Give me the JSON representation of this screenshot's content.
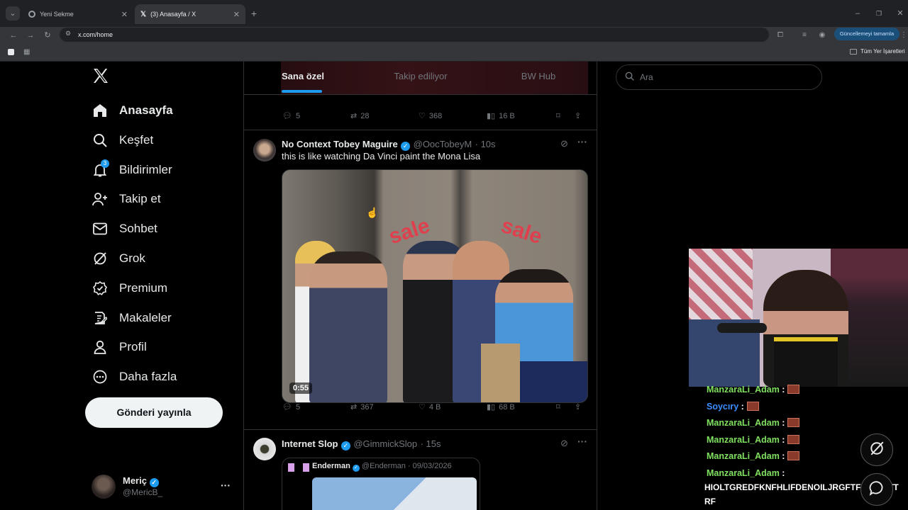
{
  "browser": {
    "tabs": [
      {
        "title": "Yeni Sekme",
        "active": false
      },
      {
        "title": "(3) Anasayfa / X",
        "active": true
      }
    ],
    "url": "x.com/home",
    "update_label": "Güncellemeyi tamamla",
    "bookmarks_label": "Tüm Yer İşaretleri"
  },
  "sidebar": {
    "logo": "X",
    "items": [
      {
        "label": "Anasayfa",
        "icon": "home-icon"
      },
      {
        "label": "Keşfet",
        "icon": "search-icon"
      },
      {
        "label": "Bildirimler",
        "icon": "bell-icon",
        "badge": "3"
      },
      {
        "label": "Takip et",
        "icon": "follow-icon"
      },
      {
        "label": "Sohbet",
        "icon": "mail-icon"
      },
      {
        "label": "Grok",
        "icon": "grok-icon"
      },
      {
        "label": "Premium",
        "icon": "premium-icon"
      },
      {
        "label": "Makaleler",
        "icon": "articles-icon"
      },
      {
        "label": "Profil",
        "icon": "profile-icon"
      },
      {
        "label": "Daha fazla",
        "icon": "more-circle-icon"
      }
    ],
    "post_button": "Gönderi yayınla",
    "account": {
      "name": "Meriç",
      "handle": "@MericB_"
    }
  },
  "timeline": {
    "tabs": [
      "Sana özel",
      "Takip ediliyor",
      "BW Hub"
    ],
    "prev_post_stats": {
      "replies": "5",
      "reposts": "28",
      "likes": "368",
      "views": "16 B"
    },
    "posts": [
      {
        "name": "No Context Tobey Maguire",
        "handle": "@OocTobeyM",
        "time": "· 10s",
        "text": "this is like watching Da Vinci paint the Mona Lisa",
        "video_duration": "0:55",
        "sign_text_1": "sale",
        "sign_text_2": "sale",
        "stats": {
          "replies": "5",
          "reposts": "367",
          "likes": "4 B",
          "views": "68 B"
        }
      },
      {
        "name": "Internet Slop",
        "handle": "@GimmickSlop",
        "time": "· 15s",
        "quoted": {
          "name": "Enderman",
          "handle": "@Enderman",
          "date": "· 09/03/2026"
        }
      }
    ]
  },
  "search": {
    "placeholder": "Ara"
  },
  "stream_chat": [
    {
      "user": "ManzaraLi_Adam",
      "color": "#7fe15f",
      "emote": true
    },
    {
      "user": "Soycıry",
      "color": "#3b8dff",
      "emote": true
    },
    {
      "user": "ManzaraLi_Adam",
      "color": "#7fe15f",
      "emote": true
    },
    {
      "user": "ManzaraLi_Adam",
      "color": "#7fe15f",
      "emote": true
    },
    {
      "user": "ManzaraLi_Adam",
      "color": "#7fe15f",
      "emote": true
    },
    {
      "user": "ManzaraLi_Adam",
      "color": "#7fe15f",
      "emote": false
    }
  ],
  "stream_chat_message": "HIOLTGREDFKNFHLIFDENOILJRGFTFIPESWTT",
  "stream_chat_message_2": "RF",
  "colors": {
    "accent": "#1d9bf0",
    "bg": "#000000",
    "border": "#2f3336"
  }
}
